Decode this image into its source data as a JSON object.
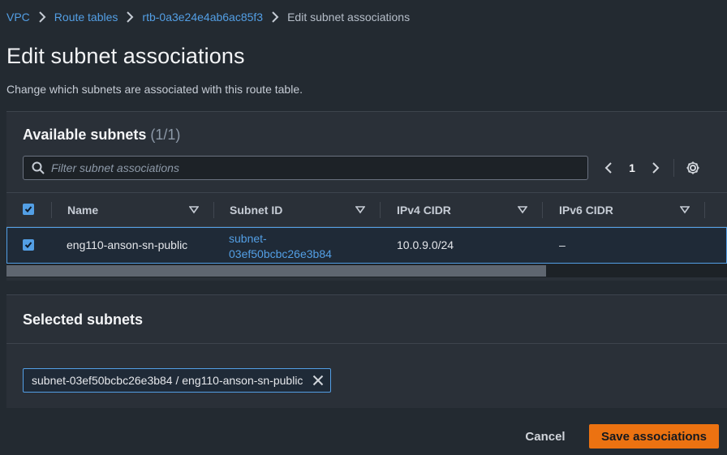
{
  "breadcrumb": {
    "items": [
      "VPC",
      "Route tables",
      "rtb-0a3e24e4ab6ac85f3"
    ],
    "current": "Edit subnet associations"
  },
  "page": {
    "title": "Edit subnet associations",
    "description": "Change which subnets are associated with this route table."
  },
  "available": {
    "title": "Available subnets",
    "count": "(1/1)",
    "filter_placeholder": "Filter subnet associations",
    "page_number": "1",
    "columns": [
      "Name",
      "Subnet ID",
      "IPv4 CIDR",
      "IPv6 CIDR"
    ],
    "rows": [
      {
        "checked": true,
        "name": "eng110-anson-sn-public",
        "subnet_id_line1": "subnet-",
        "subnet_id_line2": "03ef50bcbc26e3b84",
        "ipv4": "10.0.9.0/24",
        "ipv6": "–"
      }
    ]
  },
  "selected": {
    "title": "Selected subnets",
    "tokens": [
      "subnet-03ef50bcbc26e3b84 / eng110-anson-sn-public"
    ]
  },
  "actions": {
    "cancel": "Cancel",
    "save": "Save associations"
  },
  "colors": {
    "background": "#232a31",
    "panel": "#2a3038",
    "link": "#539fe5",
    "primary": "#ec7211"
  }
}
